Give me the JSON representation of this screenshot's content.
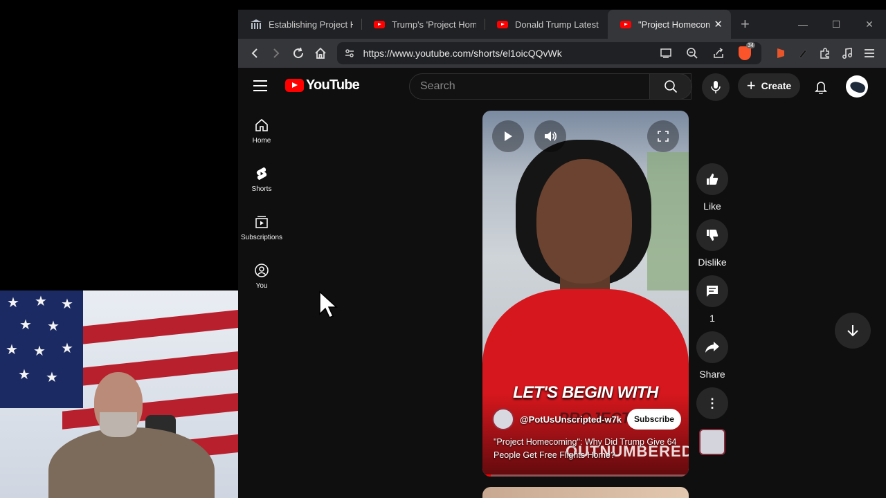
{
  "browser": {
    "tabs": [
      {
        "title": "Establishing Project Ho",
        "favicon": "government-building-icon",
        "active": false
      },
      {
        "title": "Trump's 'Project Home",
        "favicon": "youtube-icon",
        "active": false
      },
      {
        "title": "Donald Trump Latest N",
        "favicon": "youtube-icon",
        "active": false
      },
      {
        "title": "\"Project Homecoming",
        "favicon": "youtube-icon",
        "active": true
      }
    ],
    "url": "https://www.youtube.com/shorts/el1oicQQvWk",
    "shield_count": "34"
  },
  "youtube": {
    "logo_text": "YouTube",
    "search_placeholder": "Search",
    "create_label": "Create",
    "guide": [
      {
        "label": "Home",
        "icon": "home-icon"
      },
      {
        "label": "Shorts",
        "icon": "shorts-icon"
      },
      {
        "label": "Subscriptions",
        "icon": "subscriptions-icon"
      },
      {
        "label": "You",
        "icon": "account-icon"
      }
    ],
    "short": {
      "caption_line1": "LET'S BEGIN WITH",
      "caption_line2": "PROJECT",
      "chyron": "OUTNUMBERED",
      "channel_handle": "@PotUsUnscripted-w7k",
      "subscribe_label": "Subscribe",
      "title": "\"Project Homecoming\": Why Did Trump Give 64 People Get Free Flights Home?",
      "progress_fraction": 0.04
    },
    "actions": {
      "like": "Like",
      "dislike": "Dislike",
      "comments": "1",
      "share": "Share"
    }
  },
  "colors": {
    "youtube_red": "#ff0000",
    "background": "#0f0f0f",
    "chip": "#272727"
  }
}
